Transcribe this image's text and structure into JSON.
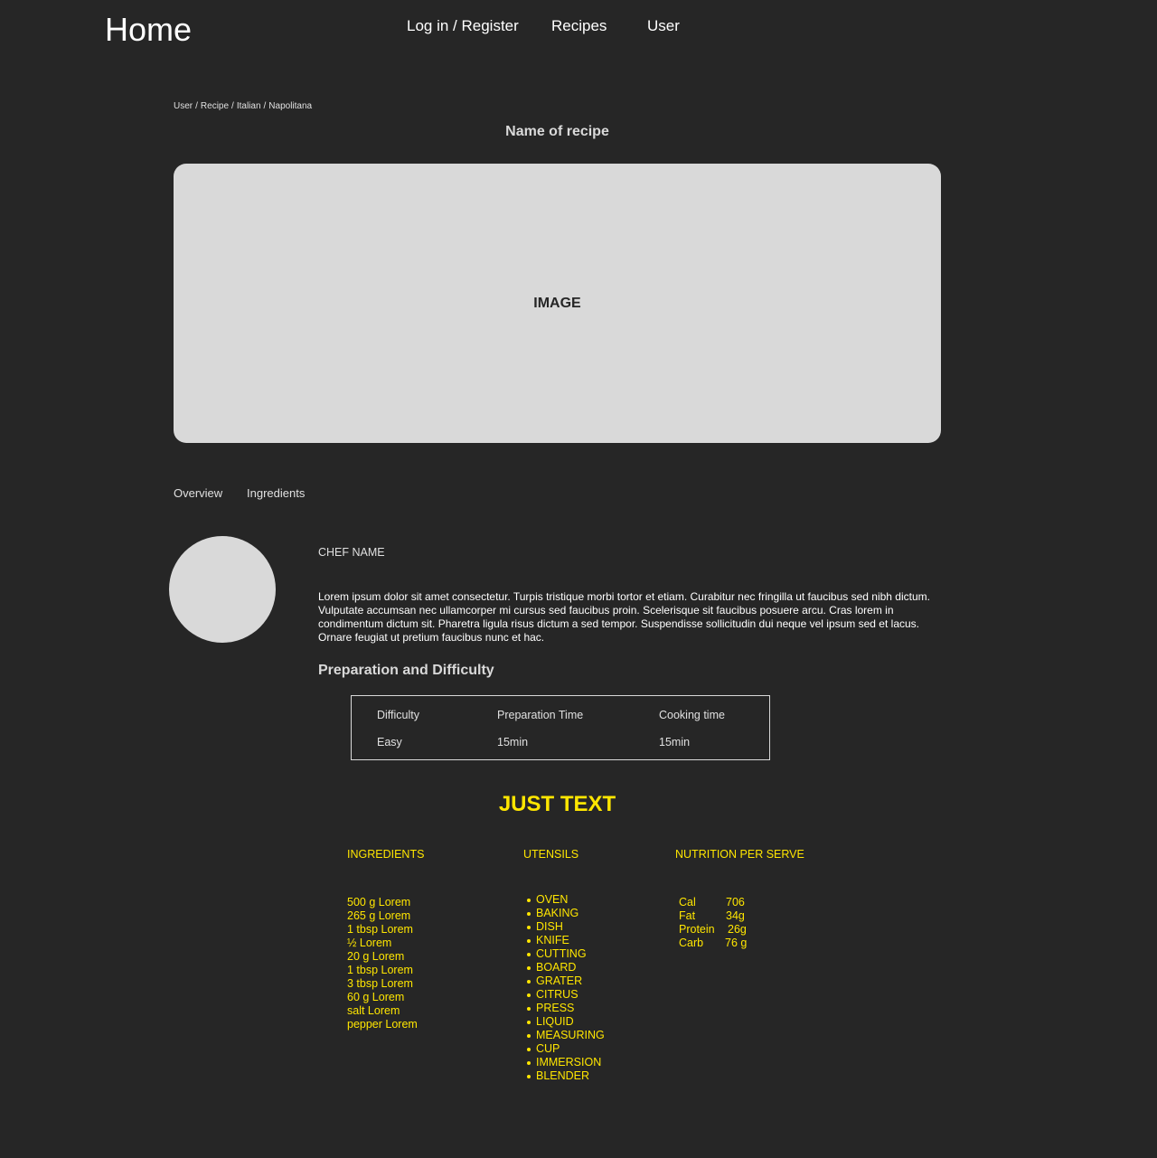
{
  "header": {
    "brand": "Home",
    "nav": [
      "Log in / Register",
      "Recipes",
      "User"
    ]
  },
  "breadcrumb": [
    "User",
    "Recipe",
    "Italian",
    "Napolitana"
  ],
  "recipe": {
    "title": "Name of recipe",
    "image_placeholder": "IMAGE"
  },
  "tabs": [
    "Overview",
    "Ingredients"
  ],
  "chef": {
    "name": "CHEF NAME",
    "description": "Lorem ipsum dolor sit amet consectetur. Turpis tristique morbi tortor et etiam. Curabitur nec fringilla ut faucibus sed nibh dictum. Vulputate accumsan nec ullamcorper mi cursus sed faucibus proin. Scelerisque sit faucibus posuere arcu. Cras lorem in condimentum dictum sit. Pharetra ligula risus dictum a sed tempor. Suspendisse sollicitudin dui neque vel ipsum sed et lacus. Ornare feugiat ut pretium faucibus nunc et hac."
  },
  "preparation": {
    "heading": "Preparation and Difficulty",
    "headers": [
      "Difficulty",
      "Preparation Time",
      "Cooking time"
    ],
    "values": [
      "Easy",
      "15min",
      "15min"
    ]
  },
  "highlight": "JUST TEXT",
  "columns": {
    "ingredients_heading": "INGREDIENTS",
    "utensils_heading": "UTENSILS",
    "nutrition_heading": "NUTRITION PER SERVE"
  },
  "ingredients": [
    "500 g Lorem",
    "265 g Lorem",
    "1 tbsp Lorem",
    "½ Lorem",
    "20 g Lorem",
    "1 tbsp Lorem",
    "3 tbsp Lorem",
    "60 g Lorem",
    "salt Lorem",
    "pepper Lorem"
  ],
  "utensils": [
    "OVEN",
    "BAKING",
    "DISH",
    "KNIFE",
    "CUTTING",
    "BOARD",
    "GRATER",
    "CITRUS",
    "PRESS",
    "LIQUID",
    "MEASURING",
    "CUP",
    "IMMERSION",
    "BLENDER"
  ],
  "nutrition": [
    {
      "label": "Cal",
      "value": "706"
    },
    {
      "label": "Fat",
      "value": "34g"
    },
    {
      "label": "Protein",
      "value": "26g"
    },
    {
      "label": "Carb",
      "value": "76 g"
    }
  ],
  "colors": {
    "background": "#262626",
    "accent": "#ffe600",
    "placeholder": "#d9d9d9"
  }
}
